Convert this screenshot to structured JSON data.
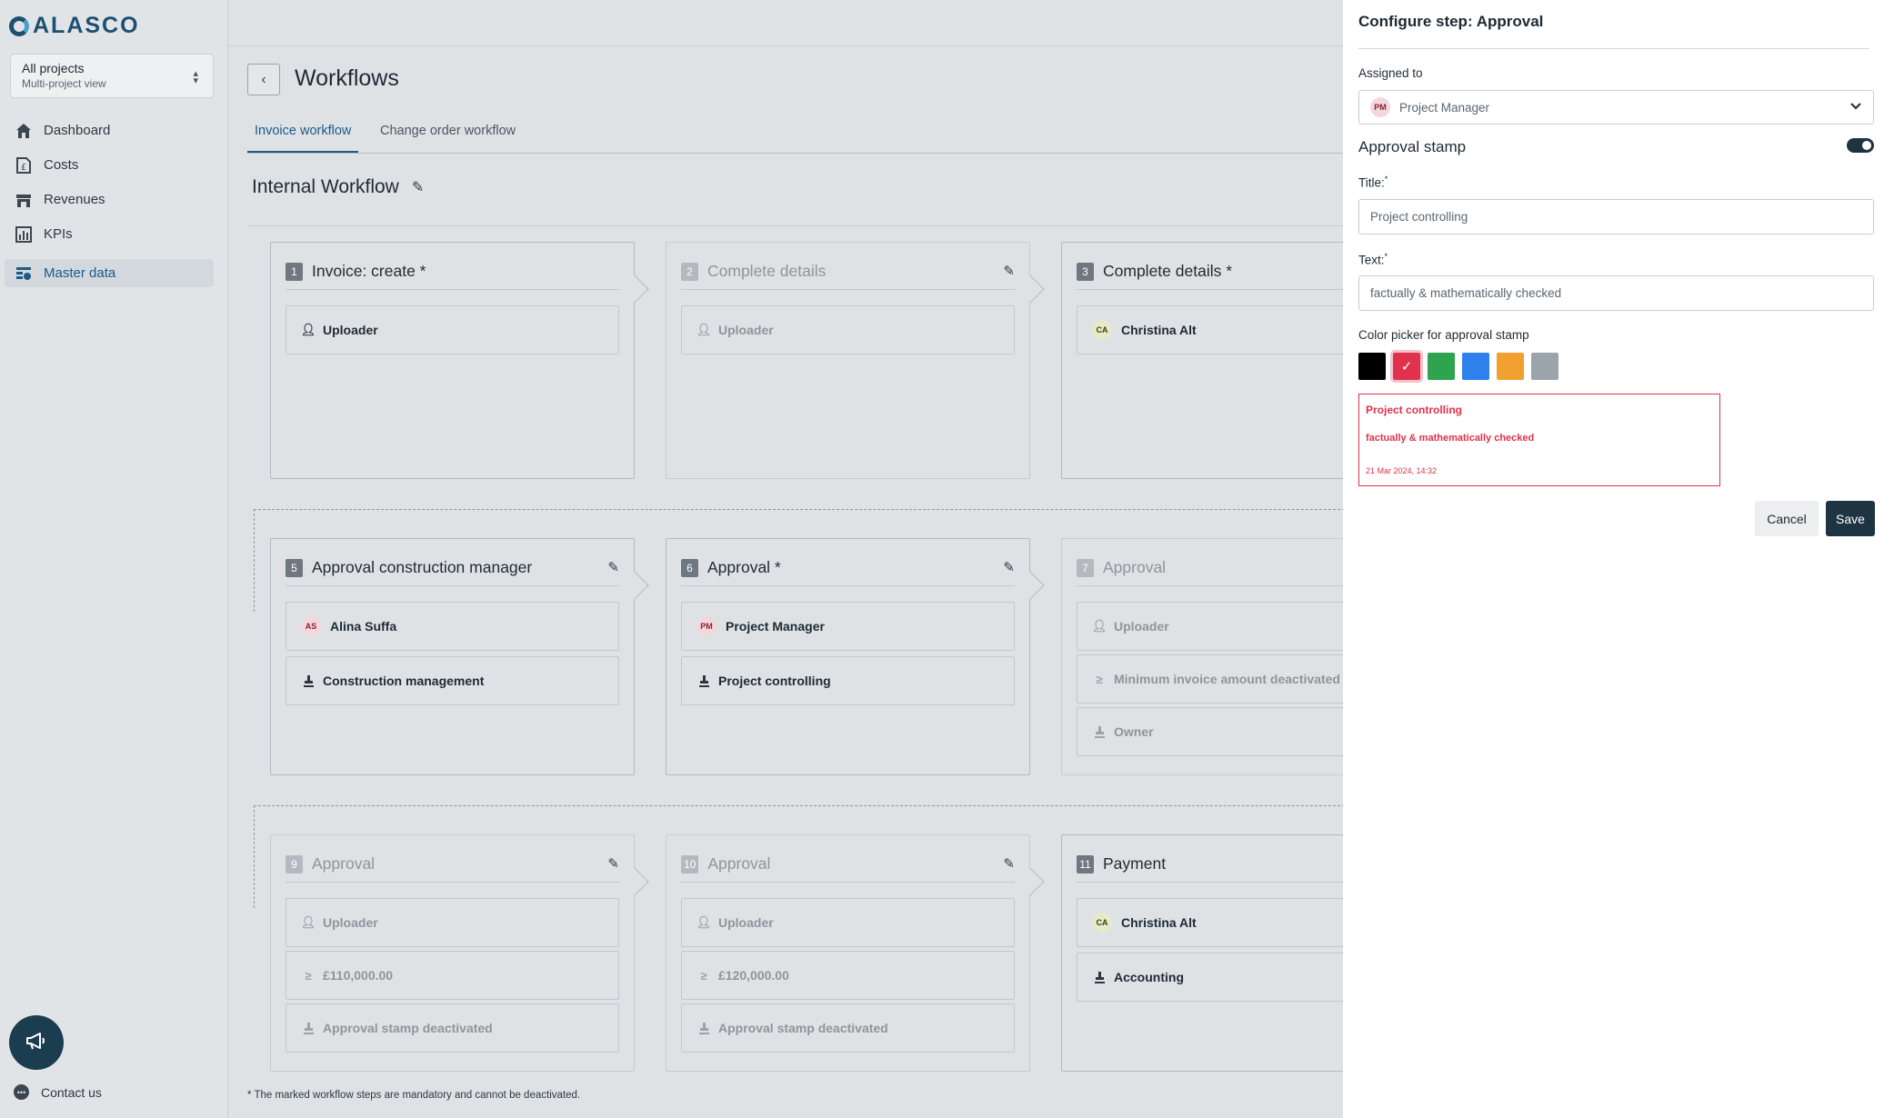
{
  "app": {
    "logo_text": "ALASCO"
  },
  "project_selector": {
    "name": "All projects",
    "subtitle": "Multi-project view"
  },
  "nav": {
    "items": [
      {
        "label": "Dashboard",
        "icon": "home-icon"
      },
      {
        "label": "Costs",
        "icon": "costs-icon"
      },
      {
        "label": "Revenues",
        "icon": "revenues-icon"
      },
      {
        "label": "KPIs",
        "icon": "kpis-icon"
      },
      {
        "label": "Master data",
        "icon": "master-data-icon",
        "active": true
      }
    ],
    "contact_label": "Contact us"
  },
  "page": {
    "title": "Workflows",
    "tabs": [
      {
        "label": "Invoice workflow",
        "active": true
      },
      {
        "label": "Change order workflow",
        "active": false
      }
    ],
    "workflow_title": "Internal Workflow",
    "footnote": "* The marked workflow steps are mandatory and cannot be deactivated."
  },
  "steps": [
    {
      "num": "1",
      "name": "Invoice: create *",
      "rows": [
        {
          "icon": "user",
          "text": "Uploader"
        }
      ]
    },
    {
      "num": "2",
      "name": "Complete details",
      "rows": [
        {
          "icon": "user",
          "text": "Uploader"
        }
      ]
    },
    {
      "num": "3",
      "name": "Complete details *",
      "rows": [
        {
          "avatar": "CA",
          "text": "Christina Alt"
        }
      ]
    },
    {
      "num": "5",
      "name": "Approval construction manager",
      "rows": [
        {
          "avatar": "AS",
          "text": "Alina Suffa"
        },
        {
          "icon": "stamp",
          "text": "Construction management"
        }
      ]
    },
    {
      "num": "6",
      "name": "Approval *",
      "rows": [
        {
          "avatar": "PM",
          "text": "Project Manager"
        },
        {
          "icon": "stamp",
          "text": "Project controlling"
        }
      ]
    },
    {
      "num": "7",
      "name": "Approval",
      "rows": [
        {
          "icon": "user",
          "text": "Uploader"
        },
        {
          "icon": "gte",
          "text": "Minimum invoice amount deactivated"
        },
        {
          "icon": "stamp",
          "text": "Owner"
        }
      ]
    },
    {
      "num": "9",
      "name": "Approval",
      "rows": [
        {
          "icon": "user",
          "text": "Uploader"
        },
        {
          "icon": "gte",
          "text": "£110,000.00"
        },
        {
          "icon": "stamp",
          "text": "Approval stamp deactivated"
        }
      ]
    },
    {
      "num": "10",
      "name": "Approval",
      "rows": [
        {
          "icon": "user",
          "text": "Uploader"
        },
        {
          "icon": "gte",
          "text": "£120,000.00"
        },
        {
          "icon": "stamp",
          "text": "Approval stamp deactivated"
        }
      ]
    },
    {
      "num": "11",
      "name": "Payment",
      "rows": [
        {
          "avatar": "CA",
          "text": "Christina Alt"
        },
        {
          "icon": "stamp",
          "text": "Accounting"
        }
      ]
    }
  ],
  "panel": {
    "title": "Configure step: Approval",
    "assigned_label": "Assigned to",
    "assigned_avatar": "PM",
    "assigned_value": "Project Manager",
    "stamp_label": "Approval stamp",
    "stamp_enabled": true,
    "title_label": "Title:",
    "title_value": "Project controlling",
    "text_label": "Text:",
    "text_value": "factually & mathematically checked",
    "required_mark": "*",
    "color_label": "Color picker for approval stamp",
    "colors": [
      "#000000",
      "#e0314d",
      "#2ea44f",
      "#2f80ed",
      "#f2a030",
      "#9aa4aa"
    ],
    "selected_color": "#e0314d",
    "preview": {
      "title": "Project controlling",
      "text": "factually & mathematically checked",
      "date": "21 Mar 2024, 14:32"
    },
    "cancel_label": "Cancel",
    "save_label": "Save"
  }
}
